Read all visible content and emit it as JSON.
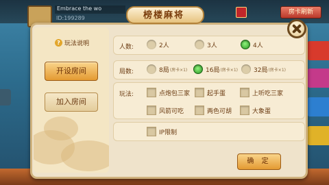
{
  "top_bar": {
    "player_name": "Embrace the wo",
    "player_id": "ID:199289",
    "refresh_label": "房卡刷新"
  },
  "dialog": {
    "title": "榜楼麻将",
    "rules_link": "玩法说明",
    "create_room": "开设房间",
    "join_room": "加入房间",
    "players": {
      "label": "人数:",
      "options": [
        "2人",
        "3人",
        "4人"
      ],
      "selected": "4人"
    },
    "rounds": {
      "label": "局数:",
      "options": [
        {
          "main": "8局",
          "sub": "(房卡×1)"
        },
        {
          "main": "16局",
          "sub": "(房卡×1)"
        },
        {
          "main": "32局",
          "sub": "(房卡×1)"
        }
      ],
      "selected": "16局"
    },
    "play": {
      "label": "玩法:",
      "options": [
        "点炮包三家",
        "起手蛋",
        "上听吃三家",
        "风箭可吃",
        "两色可胡",
        "大象蛋"
      ]
    },
    "ip_limit": "IP限制",
    "confirm": "确 定"
  },
  "colors": {
    "dialog_bg": "#efe3cb",
    "accent_orange": "#e49a32",
    "text_brown": "#6b3b12",
    "selected_green": "#2c9a24"
  }
}
